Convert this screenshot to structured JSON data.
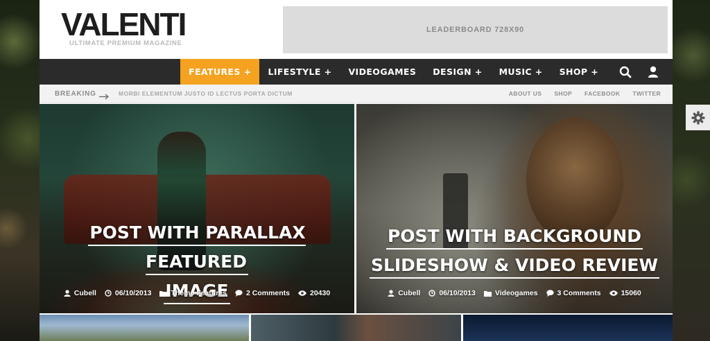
{
  "header": {
    "logo": "VALENTI",
    "tagline": "ULTIMATE PREMIUM MAGAZINE",
    "leaderboard": "LEADERBOARD 728X90"
  },
  "nav": {
    "items": [
      {
        "label": "FEATURES +"
      },
      {
        "label": "LIFESTYLE +"
      },
      {
        "label": "VIDEOGAMES"
      },
      {
        "label": "DESIGN +"
      },
      {
        "label": "MUSIC +"
      },
      {
        "label": "SHOP +"
      }
    ],
    "active_color": "#f4a21f",
    "icons": [
      "search-icon",
      "user-icon"
    ]
  },
  "breaking": {
    "label": "BREAKING",
    "text": "MORBI ELEMENTUM JUSTO ID LECTUS PORTA DICTUM",
    "links": [
      "ABOUT US",
      "SHOP",
      "FACEBOOK",
      "TWITTER"
    ]
  },
  "featured": [
    {
      "title_line1": "POST WITH PARALLAX FEATURED",
      "title_line2": "IMAGE",
      "author": "Cubell",
      "date": "06/10/2013",
      "category": "Theme Features",
      "comments": "2 Comments",
      "views": "20430"
    },
    {
      "title_line1": "POST WITH BACKGROUND",
      "title_line2": "SLIDESHOW & VIDEO REVIEW",
      "author": "Cubell",
      "date": "06/10/2013",
      "category": "Videogames",
      "comments": "3 Comments",
      "views": "15060"
    }
  ]
}
